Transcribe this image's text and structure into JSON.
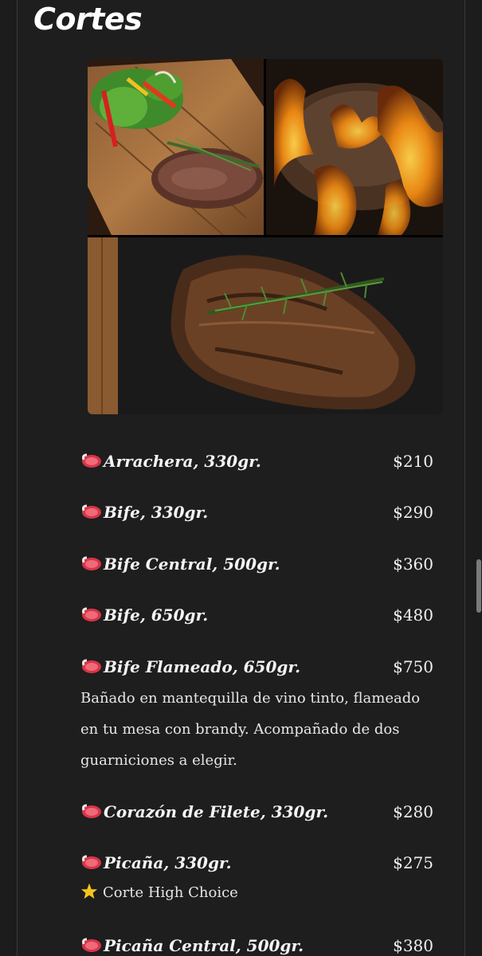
{
  "section": {
    "title": "Cortes"
  },
  "gallery": {
    "photos": [
      {
        "icon": "steak-board-photo"
      },
      {
        "icon": "flaming-steak-photo"
      },
      {
        "icon": "ribeye-rosemary-photo"
      }
    ]
  },
  "menu": {
    "items": [
      {
        "name": "Arrachera, 330gr.",
        "price": "$210"
      },
      {
        "name": "Bife, 330gr.",
        "price": "$290"
      },
      {
        "name": "Bife Central, 500gr.",
        "price": "$360"
      },
      {
        "name": "Bife, 650gr.",
        "price": "$480"
      },
      {
        "name": "Bife Flameado, 650gr.",
        "price": "$750",
        "description": "Bañado en mantequilla de vino tinto, flameado en tu mesa con brandy. Acompañado de dos guarniciones a elegir."
      },
      {
        "name": "Corazón de Filete, 330gr.",
        "price": "$280"
      },
      {
        "name": "Picaña, 330gr.",
        "price": "$275",
        "note": "Corte High Choice"
      },
      {
        "name": "Picaña Central, 500gr.",
        "price": "$380"
      }
    ]
  },
  "colors": {
    "background": "#1c1c1c",
    "text": "#f4f4f4",
    "steak_icon": "#d8344a",
    "star_icon": "#f5c518"
  }
}
